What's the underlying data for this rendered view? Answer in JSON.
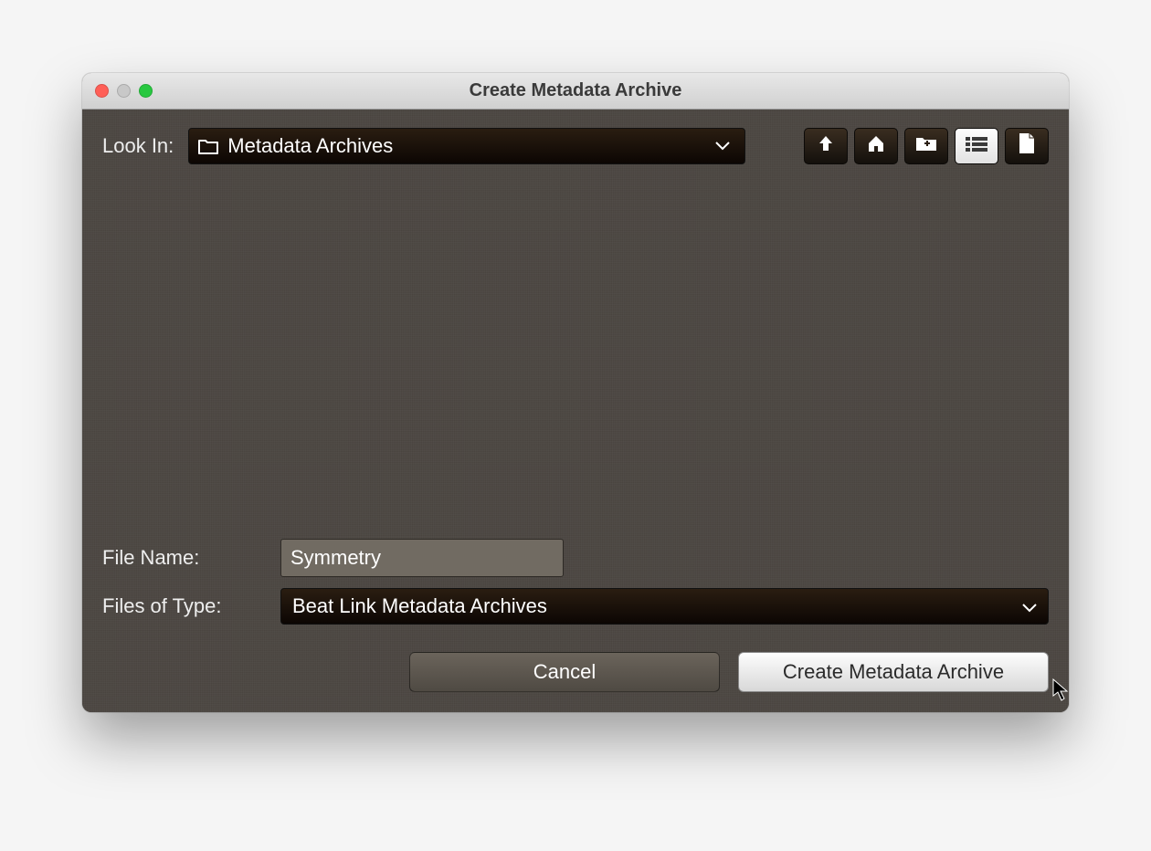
{
  "window": {
    "title": "Create Metadata Archive"
  },
  "toolbar": {
    "look_in_label": "Look In:",
    "look_in_value": "Metadata Archives",
    "icons": {
      "up": "up-icon",
      "home": "home-icon",
      "new_folder": "new-folder-icon",
      "list_view": "list-view-icon",
      "details_view": "details-view-icon"
    }
  },
  "form": {
    "file_name_label": "File Name:",
    "file_name_value": "Symmetry",
    "file_type_label": "Files of Type:",
    "file_type_value": "Beat Link Metadata Archives"
  },
  "buttons": {
    "cancel": "Cancel",
    "create": "Create Metadata Archive"
  }
}
